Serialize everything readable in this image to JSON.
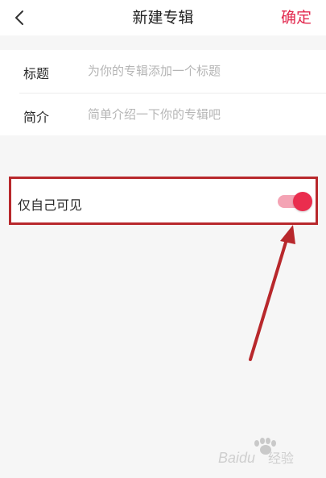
{
  "header": {
    "title": "新建专辑",
    "confirm_label": "确定",
    "accent_color": "#e2284e"
  },
  "form": {
    "title_label": "标题",
    "title_placeholder": "为你的专辑添加一个标题",
    "intro_label": "简介",
    "intro_placeholder": "简单介绍一下你的专辑吧"
  },
  "privacy": {
    "label": "仅自己可见",
    "toggle_on": true,
    "toggle_color": "#ea2d4e"
  },
  "annotation": {
    "highlight_color": "#b8282c"
  },
  "watermark": {
    "brand": "Baidu",
    "suffix": "经验"
  }
}
